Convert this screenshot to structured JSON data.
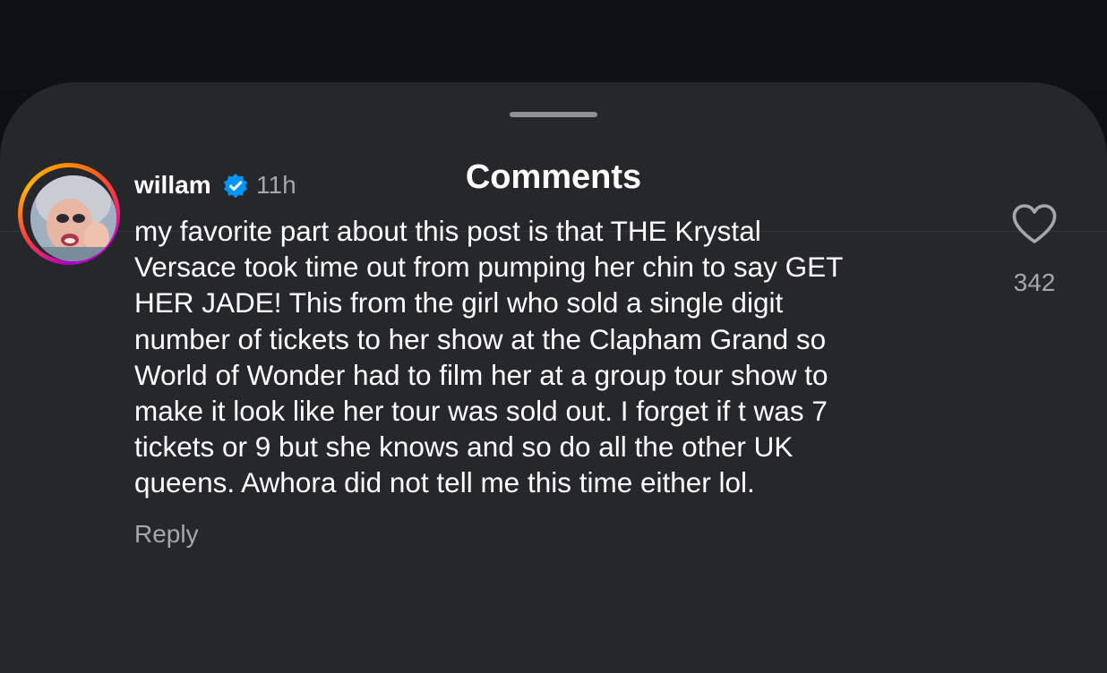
{
  "sheet": {
    "title": "Comments"
  },
  "comment": {
    "username": "willam",
    "verified_icon": "verified-badge-icon",
    "time": "11h",
    "text_lines": [
      "my favorite part about this post is that THE Krystal",
      "Versace took time out from pumping her chin to say GET",
      "HER JADE! This from the girl who sold a single digit",
      "number of tickets to her show at the Clapham Grand so",
      "World of Wonder had to film her at a group tour show to",
      "make it look like her tour was sold out. I forget if t was 7",
      "tickets or 9 but she knows and so do all the other UK",
      "queens. Awhora did not tell me this time either lol."
    ],
    "reply_label": "Reply",
    "like_icon": "heart-icon",
    "like_count": "342"
  },
  "colors": {
    "sheet_bg": "#25272b",
    "text_primary": "#ffffff",
    "text_secondary": "#a4a7ad",
    "verified_blue": "#0095f6"
  }
}
